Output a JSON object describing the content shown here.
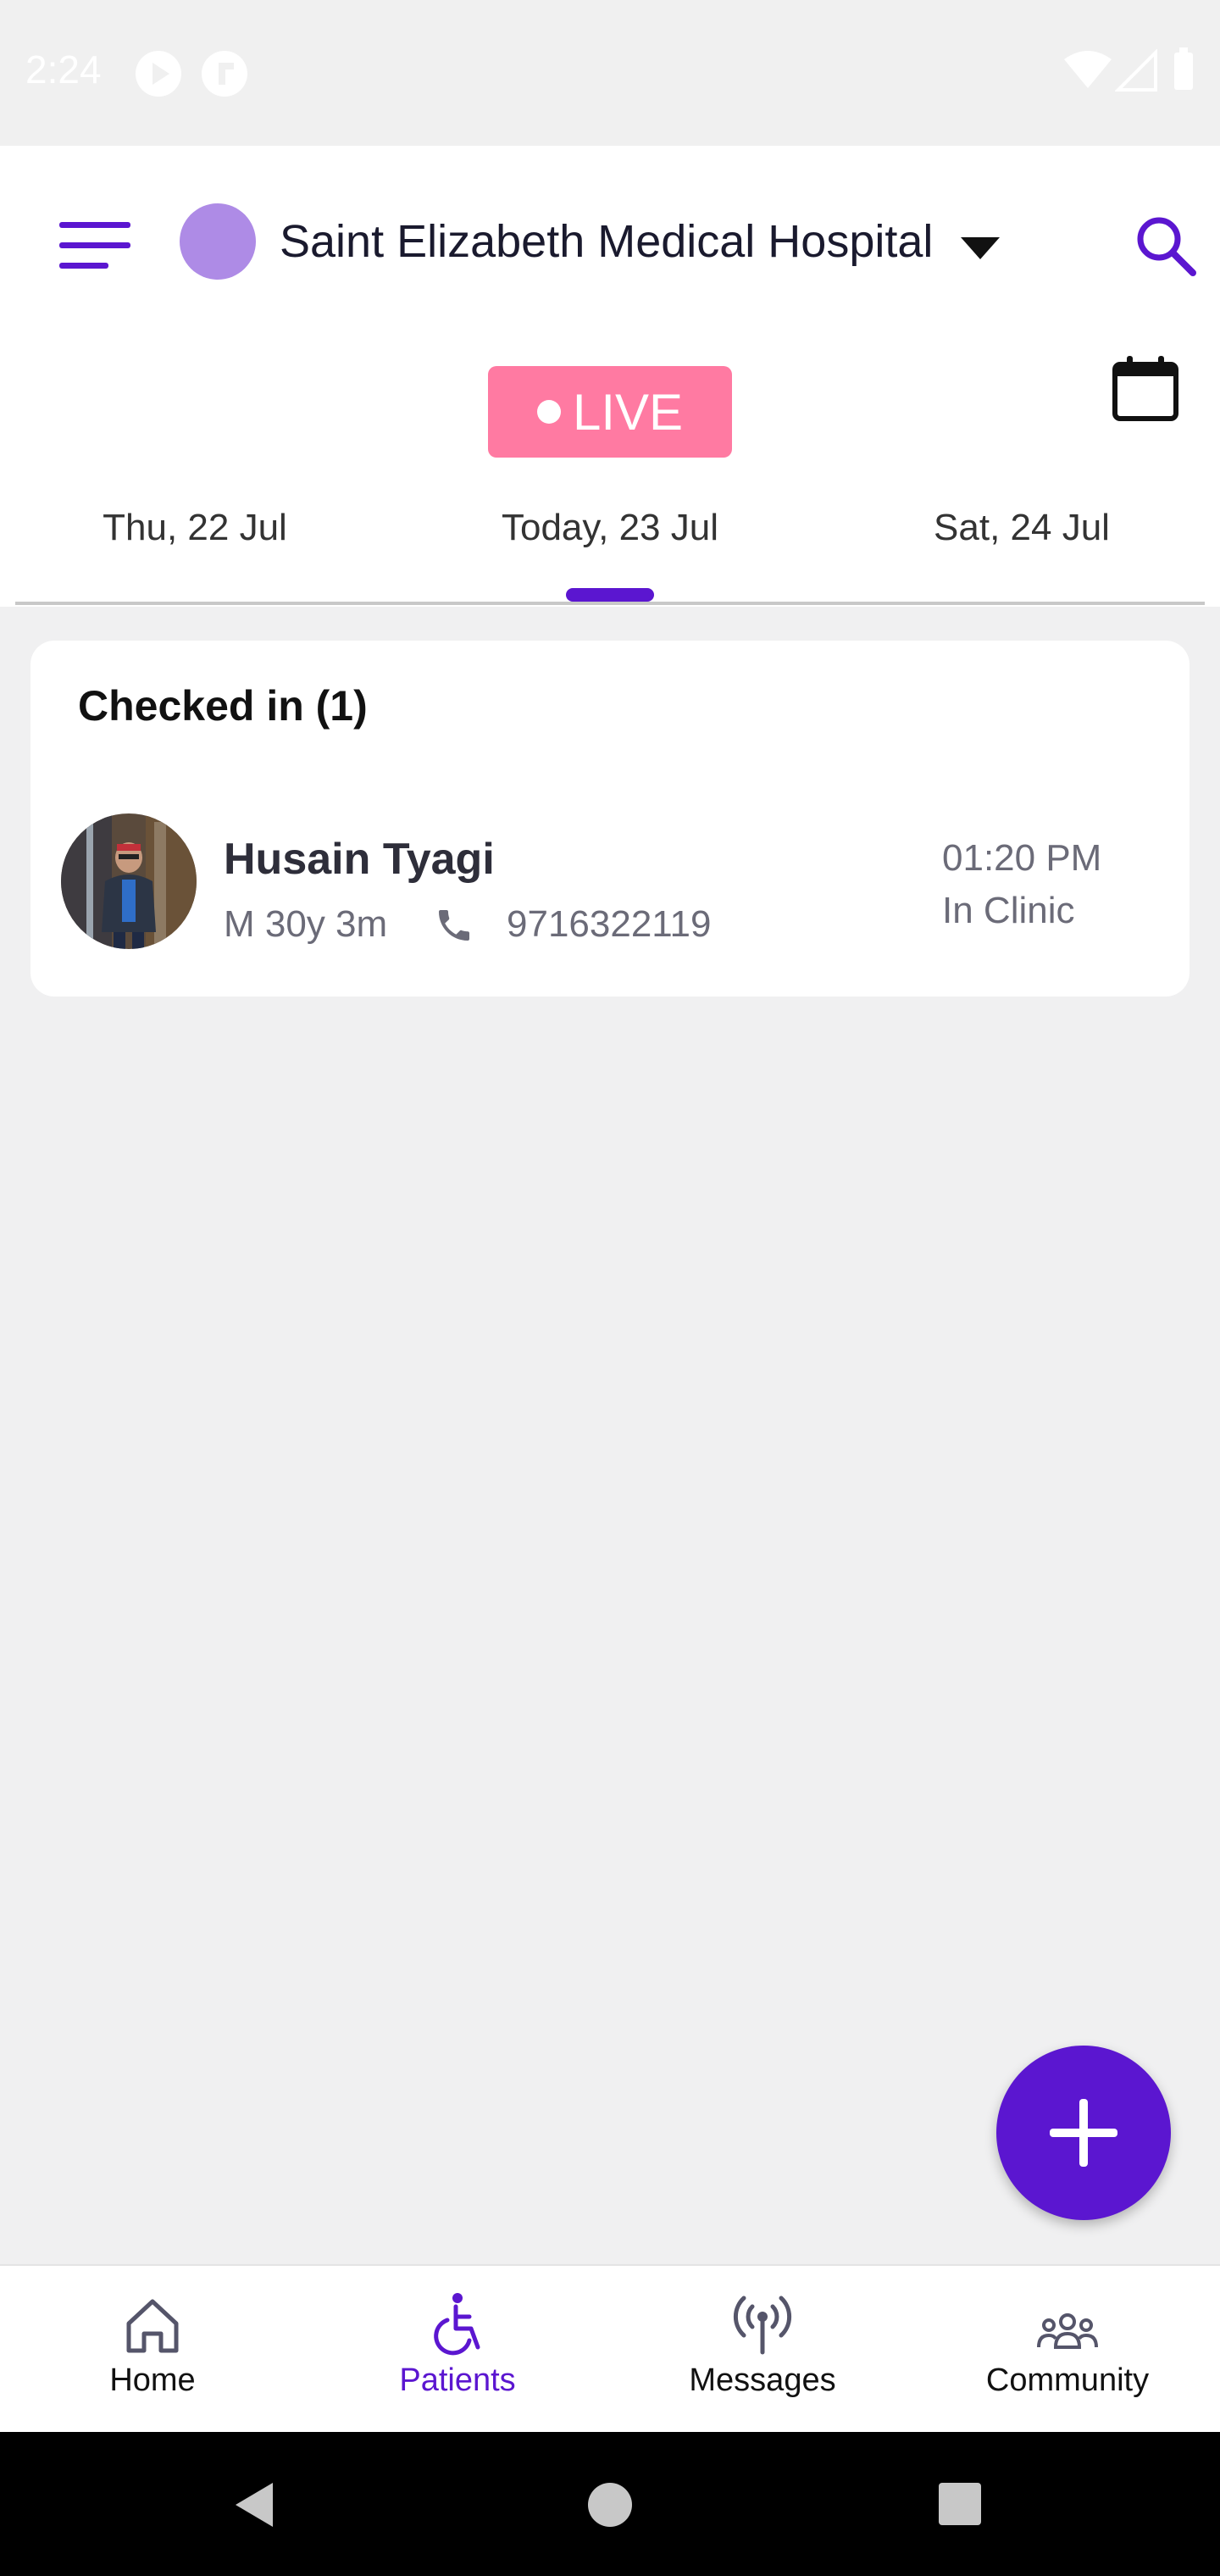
{
  "status_bar": {
    "time": "2:24"
  },
  "header": {
    "hospital_name": "Saint Elizabeth Medical Hospital",
    "hospital_avatar_color": "#ae8be6",
    "accent_color": "#5b16d0"
  },
  "live_badge": {
    "label": "LIVE",
    "color": "#ff7aa2"
  },
  "date_tabs": [
    {
      "label": "Thu, 22 Jul"
    },
    {
      "label": "Today, 23 Jul",
      "selected": true
    },
    {
      "label": "Sat, 24 Jul"
    }
  ],
  "checked_in": {
    "title": "Checked in (1)",
    "patients": [
      {
        "name": "Husain Tyagi",
        "meta": "M 30y 3m",
        "phone": "9716322119",
        "time": "01:20 PM",
        "status": "In Clinic"
      }
    ]
  },
  "fab": {
    "icon": "plus-icon"
  },
  "bottom_nav": [
    {
      "label": "Home",
      "icon": "home-icon"
    },
    {
      "label": "Patients",
      "icon": "wheelchair-icon",
      "selected": true
    },
    {
      "label": "Messages",
      "icon": "broadcast-icon"
    },
    {
      "label": "Community",
      "icon": "people-icon"
    }
  ]
}
